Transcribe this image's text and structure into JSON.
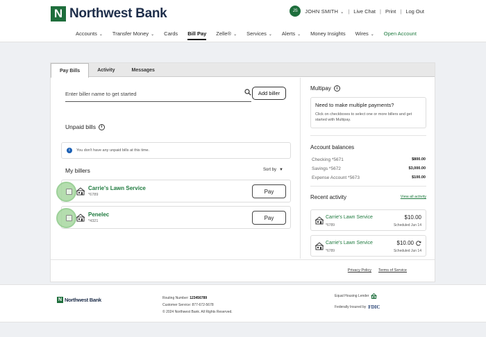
{
  "header": {
    "brand": "Northwest Bank",
    "logo_letter": "N",
    "user_initials": "JS",
    "user_name": "JOHN SMITH",
    "live_chat": "Live Chat",
    "print": "Print",
    "logout": "Log Out",
    "nav": [
      {
        "label": "Accounts",
        "chevron": true
      },
      {
        "label": "Transfer Money",
        "chevron": true
      },
      {
        "label": "Cards",
        "chevron": false
      },
      {
        "label": "Bill Pay",
        "chevron": false,
        "active": true
      },
      {
        "label": "Zelle®",
        "chevron": true
      },
      {
        "label": "Services",
        "chevron": true
      },
      {
        "label": "Alerts",
        "chevron": true
      },
      {
        "label": "Money Insights",
        "chevron": false
      },
      {
        "label": "Wires",
        "chevron": true
      },
      {
        "label": "Open Account",
        "chevron": false,
        "green": true
      }
    ]
  },
  "tabs": [
    "Pay Bills",
    "Activity",
    "Messages"
  ],
  "left": {
    "search_placeholder": "Enter biller name to get started",
    "add_biller": "Add biller",
    "unpaid_title": "Unpaid bills",
    "unpaid_notice": "You don't have any unpaid bills at this time.",
    "my_billers_title": "My billers",
    "sort_by": "Sort by",
    "billers": [
      {
        "name": "Carrie's Lawn Service",
        "account": "*6789",
        "pay": "Pay"
      },
      {
        "name": "Penelec",
        "account": "*4321",
        "pay": "Pay"
      }
    ]
  },
  "right": {
    "multipay_title": "Multipay",
    "multipay_head": "Need to make multiple payments?",
    "multipay_body": "Click on checkboxes to select one or more billers and get started with Multipay.",
    "balances_title": "Account balances",
    "balances": [
      {
        "name": "Checking *5671",
        "amount": "$800.00"
      },
      {
        "name": "Savings *5672",
        "amount": "$3,000.00"
      },
      {
        "name": "Expense Account *5673",
        "amount": "$100.00"
      }
    ],
    "recent_title": "Recent activity",
    "view_all": "View all activity",
    "recent": [
      {
        "name": "Carrie's Lawn Service",
        "account": "*6789",
        "amount": "$10.00",
        "status": "Scheduled Jun 14",
        "recurring": false
      },
      {
        "name": "Carrie's Lawn Service",
        "account": "*6789",
        "amount": "$10.00",
        "status": "Scheduled Jun 14",
        "recurring": true
      }
    ]
  },
  "legal": {
    "privacy": "Privacy Policy",
    "terms": "Terms of Service"
  },
  "footer": {
    "brand": "Northwest Bank",
    "routing_label": "Routing Number:",
    "routing": "123456789",
    "service": "Customer Service: 877-672-5678",
    "copyright": "© 2024 Northwest Bank. All Rights Reserved.",
    "ehl": "Equal Housing Lender",
    "fdic_prefix": "Federally Insured by",
    "fdic": "FDIC"
  },
  "colors": {
    "brand_green": "#1e6e3c",
    "link_green": "#1e7a3e",
    "navy": "#1e2e4a"
  }
}
